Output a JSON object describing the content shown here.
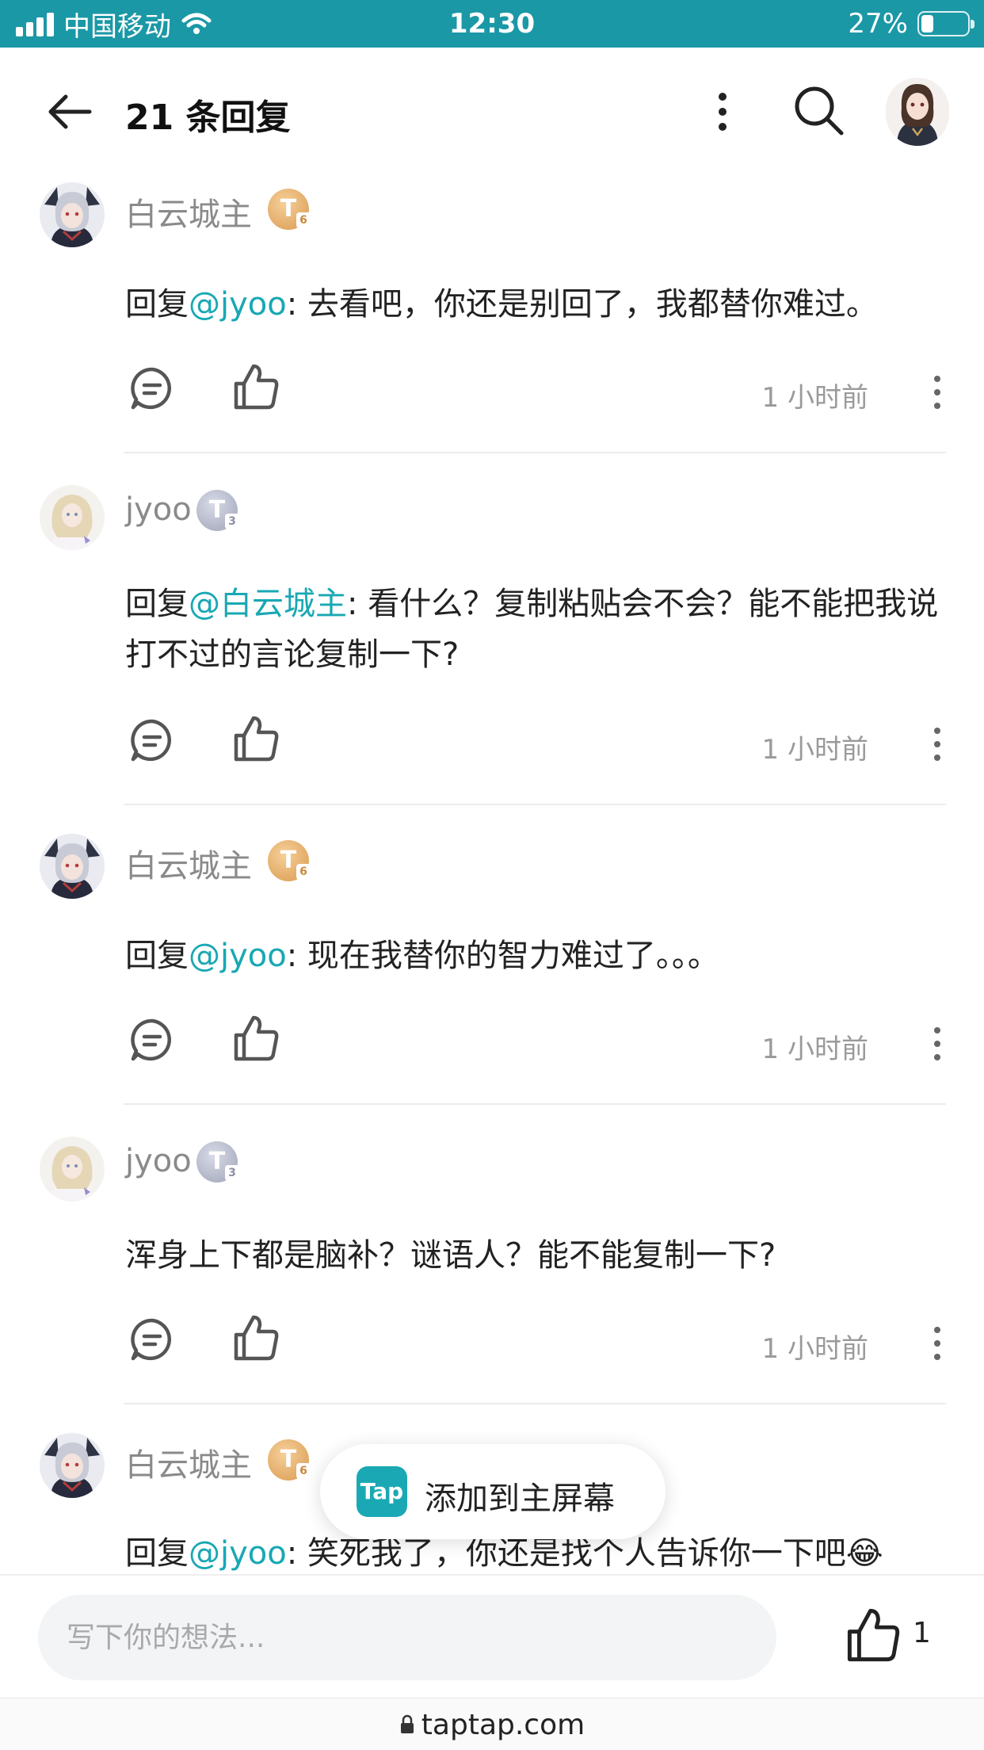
{
  "status_bar": {
    "carrier": "中国移动",
    "time": "12:30",
    "battery": "27%",
    "battery_level": 0.27
  },
  "header": {
    "title": "21 条回复",
    "back_icon": "back-arrow-icon",
    "more_icon": "more-vertical-icon",
    "search_icon": "search-icon"
  },
  "comments": [
    {
      "username": "白云城主",
      "badge_level": "6",
      "badge_color": "#d99a51",
      "reply_prefix": "回复",
      "mention": "@jyoo",
      "text": ": 去看吧，你还是别回了，我都替你难过。",
      "time": "1 小时前"
    },
    {
      "username": "jyoo",
      "badge_level": "3",
      "badge_color": "#9ea3b7",
      "reply_prefix": "回复",
      "mention": "@白云城主",
      "text": ": 看什么？复制粘贴会不会？能不能把我说打不过的言论复制一下?",
      "time": "1 小时前"
    },
    {
      "username": "白云城主",
      "badge_level": "6",
      "badge_color": "#d99a51",
      "reply_prefix": "回复",
      "mention": "@jyoo",
      "text": ": 现在我替你的智力难过了。。。",
      "time": "1 小时前"
    },
    {
      "username": "jyoo",
      "badge_level": "3",
      "badge_color": "#9ea3b7",
      "text": "浑身上下都是脑补？谜语人？能不能复制一下?",
      "time": "1 小时前"
    },
    {
      "username": "白云城主",
      "badge_level": "6",
      "badge_color": "#d99a51",
      "reply_prefix": "回复",
      "mention": "@jyoo",
      "text": ": 笑死我了，你还是找个人告诉你一下吧😂"
    }
  ],
  "toast": {
    "logo": "Tap",
    "text": "添加到主屏幕"
  },
  "bottom_bar": {
    "placeholder": "写下你的想法...",
    "like_count": "1"
  },
  "url_bar": {
    "url": "taptap.com"
  },
  "colors": {
    "accent": "#18a8b3",
    "status_bar": "#1b98a6"
  }
}
